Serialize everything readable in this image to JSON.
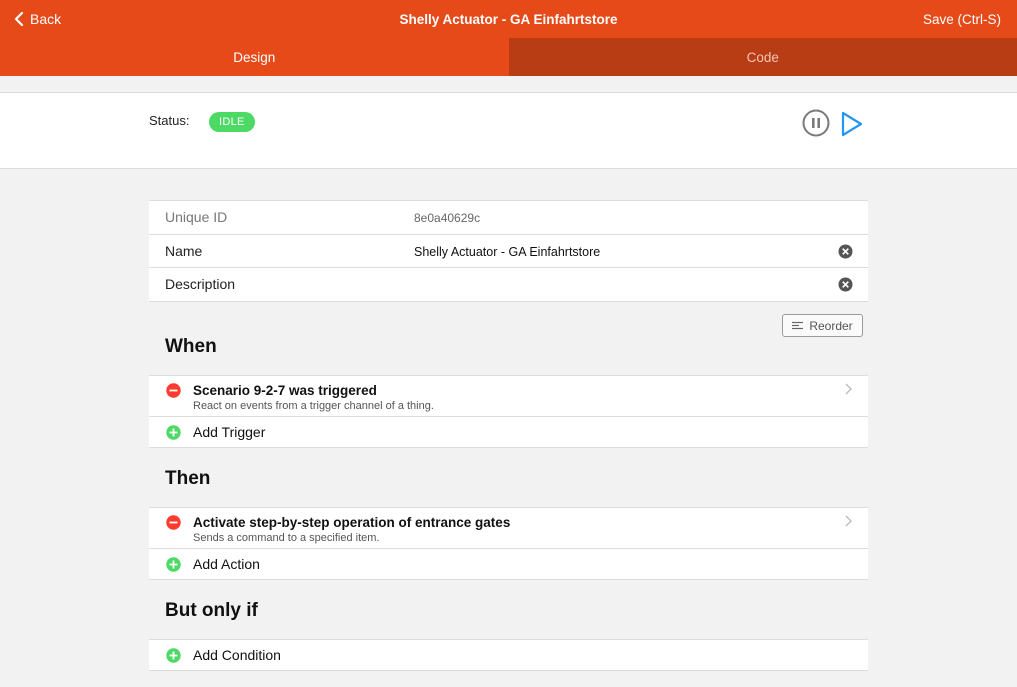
{
  "header": {
    "back_label": "Back",
    "title": "Shelly Actuator - GA Einfahrtstore",
    "save_label": "Save (Ctrl-S)"
  },
  "tabs": [
    {
      "label": "Design",
      "active": true
    },
    {
      "label": "Code",
      "active": false
    }
  ],
  "status": {
    "label": "Status:",
    "value": "IDLE"
  },
  "info": {
    "uid_label": "Unique ID",
    "uid_value": "8e0a40629c",
    "name_label": "Name",
    "name_value": "Shelly Actuator - GA Einfahrtstore",
    "description_label": "Description",
    "description_value": ""
  },
  "reorder_label": "Reorder",
  "when": {
    "title": "When",
    "triggers": [
      {
        "title": "Scenario 9-2-7 was triggered",
        "subtitle": "React on events from a trigger channel of a thing."
      }
    ],
    "add_label": "Add Trigger"
  },
  "then": {
    "title": "Then",
    "actions": [
      {
        "title": "Activate step-by-step operation of entrance gates",
        "subtitle": "Sends a command to a specified item."
      }
    ],
    "add_label": "Add Action"
  },
  "but_only_if": {
    "title": "But only if",
    "add_label": "Add Condition"
  },
  "colors": {
    "brand": "#e64a19",
    "tab_inactive": "#b83c14",
    "status_idle": "#4cd964",
    "remove": "#ff3b30",
    "add": "#4cd964",
    "play": "#2196f3"
  }
}
